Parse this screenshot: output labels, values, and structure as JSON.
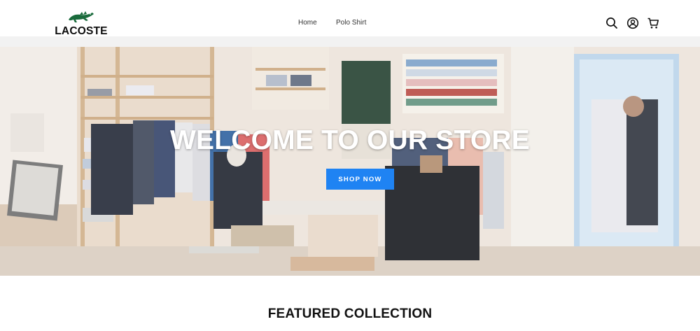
{
  "header": {
    "logo_text": "LACOSTE",
    "nav": [
      {
        "label": "Home"
      },
      {
        "label": "Polo Shirt"
      }
    ],
    "icons": [
      "search-icon",
      "account-icon",
      "cart-icon"
    ]
  },
  "hero": {
    "title": "WELCOME TO OUR STORE",
    "button_label": "SHOP NOW",
    "button_color": "#1f83f3"
  },
  "featured": {
    "title": "FEATURED COLLECTION"
  }
}
